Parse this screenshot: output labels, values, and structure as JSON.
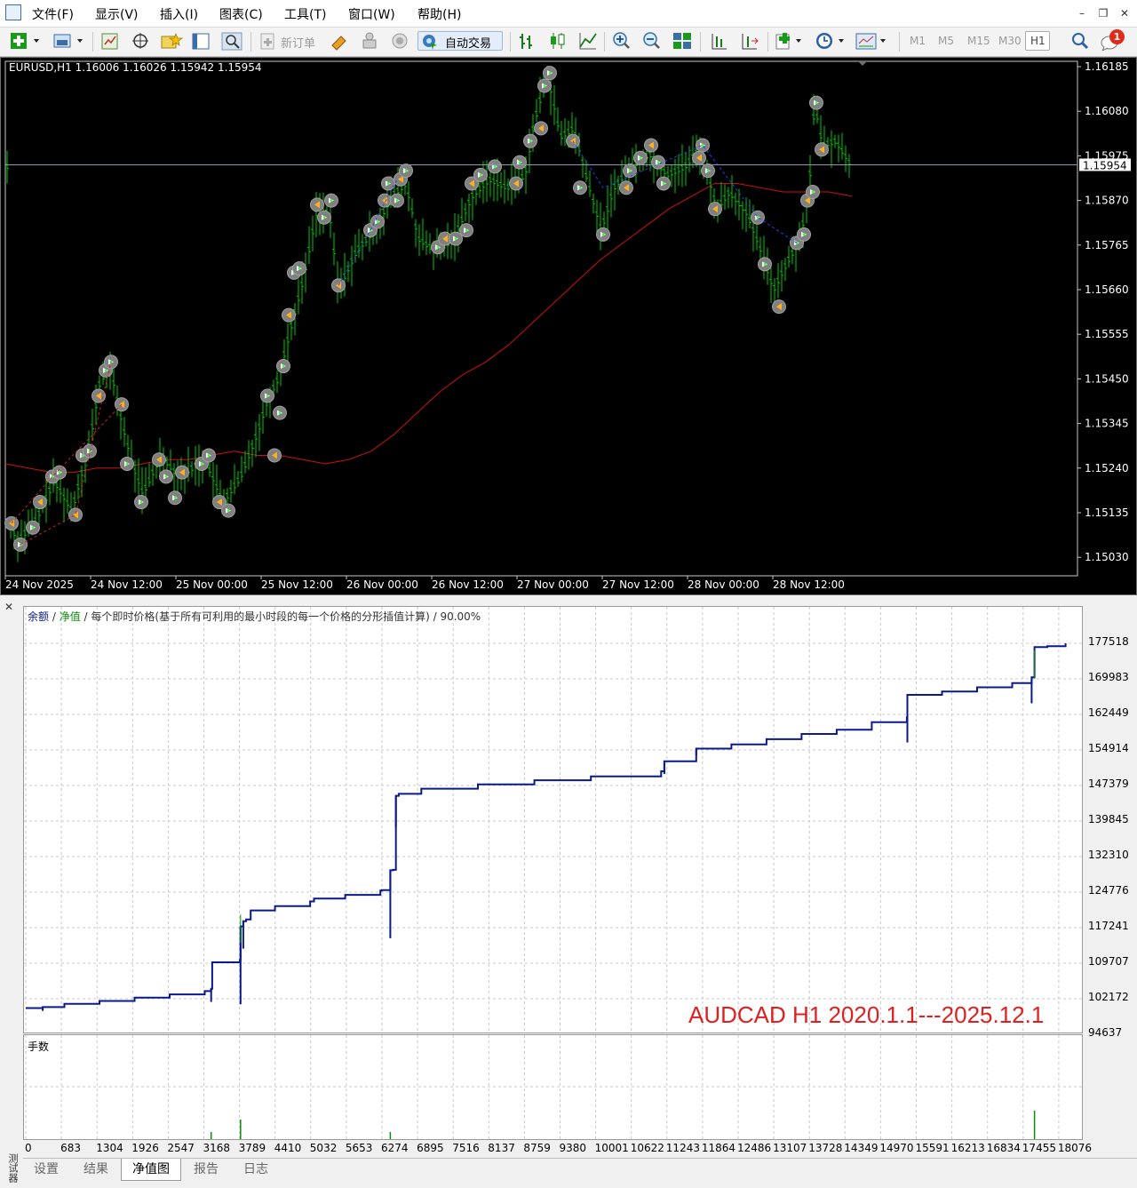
{
  "menu": {
    "items": [
      "文件(F)",
      "显示(V)",
      "插入(I)",
      "图表(C)",
      "工具(T)",
      "窗口(W)",
      "帮助(H)"
    ]
  },
  "toolbar": {
    "new_order_label": "新订单",
    "auto_trade_label": "自动交易",
    "timeframes": [
      "M1",
      "M5",
      "M15",
      "M30",
      "H1"
    ],
    "notification_count": "1"
  },
  "chart": {
    "header": "EURUSD,H1  1.16006 1.16026 1.15942 1.15954",
    "current_price": "1.15954",
    "colors": {
      "background": "#000000",
      "candle": "#00c800",
      "ma": "#d01010",
      "grid": "#303030"
    }
  },
  "chart_data": [
    {
      "type": "line",
      "symbol": "EURUSD",
      "timeframe": "H1",
      "y_tick_labels": [
        "1.16185",
        "1.16080",
        "1.15975",
        "1.15870",
        "1.15765",
        "1.15660",
        "1.15555",
        "1.15450",
        "1.15345",
        "1.15240",
        "1.15135",
        "1.15030"
      ],
      "ylim": [
        1.1503,
        1.16185
      ],
      "x_tick_labels": [
        "24 Nov 2025",
        "24 Nov 12:00",
        "25 Nov 00:00",
        "25 Nov 12:00",
        "26 Nov 00:00",
        "26 Nov 12:00",
        "27 Nov 00:00",
        "27 Nov 12:00",
        "28 Nov 00:00",
        "28 Nov 12:00"
      ],
      "series": [
        {
          "values": [
            1.1525,
            1.1524,
            1.1523,
            1.1523,
            1.1524,
            1.1524,
            1.1525,
            1.1526,
            1.1526,
            1.1527,
            1.1528,
            1.1527,
            1.1527,
            1.1526,
            1.1525,
            1.1526,
            1.1528,
            1.1532,
            1.1537,
            1.1542,
            1.1546,
            1.1549,
            1.1553,
            1.1558,
            1.1563,
            1.1568,
            1.1573,
            1.1577,
            1.1581,
            1.1585,
            1.1588,
            1.1591,
            1.1591,
            1.159,
            1.1589,
            1.1589,
            1.1589,
            1.1588
          ]
        }
      ]
    },
    {
      "type": "line",
      "legend": [
        "余额",
        "净值"
      ],
      "subtitle": "每个即时价格(基于所有可利用的最小时段的每一个价格的分形插值计算)",
      "quality": "90.00%",
      "annotation": "AUDCAD H1 2020.1.1---2025.12.1",
      "y_tick_labels": [
        "177518",
        "169983",
        "162449",
        "154914",
        "147379",
        "139845",
        "132310",
        "124776",
        "117241",
        "109707",
        "102172",
        "94637"
      ],
      "ylim": [
        94637,
        177518
      ],
      "x_tick_labels": [
        "0",
        "683",
        "1304",
        "1926",
        "2547",
        "3168",
        "3789",
        "4410",
        "5032",
        "5653",
        "6274",
        "6895",
        "7516",
        "8137",
        "8759",
        "9380",
        "10001",
        "10622",
        "11243",
        "11864",
        "12486",
        "13107",
        "13728",
        "14349",
        "14970",
        "15591",
        "16213",
        "16834",
        "17455",
        "18076"
      ],
      "series": [
        {
          "name": "余额",
          "x": [
            0,
            300,
            683,
            1304,
            1926,
            2547,
            3168,
            3280,
            3300,
            3789,
            3800,
            3850,
            3900,
            3980,
            4410,
            5032,
            5100,
            5653,
            6274,
            6300,
            6450,
            6500,
            6550,
            6600,
            7000,
            8000,
            9000,
            10000,
            11243,
            11300,
            11864,
            12486,
            13107,
            13728,
            14349,
            14970,
            15591,
            15600,
            16213,
            16834,
            17455,
            17800,
            17850,
            18076,
            18400
          ],
          "values": [
            100200,
            100400,
            101100,
            101700,
            102400,
            103100,
            103800,
            104300,
            109900,
            110400,
            117500,
            118600,
            119000,
            120900,
            121800,
            122800,
            123400,
            124200,
            125100,
            125200,
            129400,
            129500,
            145200,
            145600,
            146700,
            147600,
            148500,
            149300,
            150400,
            152500,
            155200,
            156100,
            157200,
            158300,
            159200,
            160800,
            161800,
            166600,
            167300,
            168200,
            169100,
            170300,
            176700,
            176900,
            177518
          ]
        }
      ]
    }
  ],
  "equity_panel": {
    "legend_balance": "余额",
    "legend_equity": "净值",
    "legend_rest": " / 每个即时价格(基于所有可利用的最小时段的每一个价格的分形插值计算) / 90.00%",
    "annotation": "AUDCAD H1 2020.1.1---2025.12.1",
    "colors": {
      "balance": "#0a1a8c",
      "equity": "#0a8c0a",
      "annotation": "#e02020"
    }
  },
  "lots_panel": {
    "label": "手数"
  },
  "tabs": [
    "设置",
    "结果",
    "净值图",
    "报告",
    "日志"
  ],
  "active_tab": "净值图",
  "side_label": "测试器"
}
